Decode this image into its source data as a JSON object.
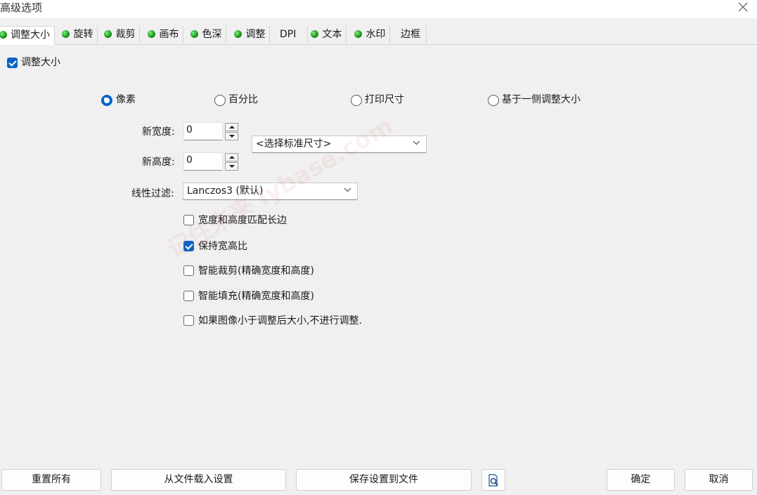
{
  "window": {
    "title": "高级选项"
  },
  "tabs": [
    {
      "label": "调整大小",
      "has_led": true
    },
    {
      "label": "旋转",
      "has_led": true
    },
    {
      "label": "裁剪",
      "has_led": true
    },
    {
      "label": "画布",
      "has_led": true
    },
    {
      "label": "色深",
      "has_led": true
    },
    {
      "label": "调整",
      "has_led": true
    },
    {
      "label": "DPI",
      "has_led": false
    },
    {
      "label": "文本",
      "has_led": true
    },
    {
      "label": "水印",
      "has_led": true
    },
    {
      "label": "边框",
      "has_led": false
    }
  ],
  "resize": {
    "enable_label": "调整大小",
    "enable_checked": true,
    "units": [
      {
        "label": "像素",
        "selected": true
      },
      {
        "label": "百分比",
        "selected": false
      },
      {
        "label": "打印尺寸",
        "selected": false
      },
      {
        "label": "基于一侧调整大小",
        "selected": false
      }
    ],
    "width_label": "新宽度:",
    "width_value": "0",
    "height_label": "新高度:",
    "height_value": "0",
    "standard_size": "<选择标准尺寸>",
    "filter_label": "线性过滤:",
    "filter_value": "Lanczos3 (默认)",
    "options": [
      {
        "label": "宽度和高度匹配长边",
        "checked": false
      },
      {
        "label": "保持宽高比",
        "checked": true
      },
      {
        "label": "智能裁剪(精确宽度和高度)",
        "checked": false
      },
      {
        "label": "智能填充(精确宽度和高度)",
        "checked": false
      },
      {
        "label": "如果图像小于调整后大小,不进行调整.",
        "checked": false
      }
    ]
  },
  "footer": {
    "reset_all": "重置所有",
    "load_from_file": "从文件载入设置",
    "save_to_file": "保存设置到文件",
    "ok": "确定",
    "cancel": "取消"
  },
  "watermark": "记住未来 lybase.com",
  "colors": {
    "accent": "#0a63c9",
    "led": "#1f9a1f",
    "background": "#f0f0f0"
  }
}
